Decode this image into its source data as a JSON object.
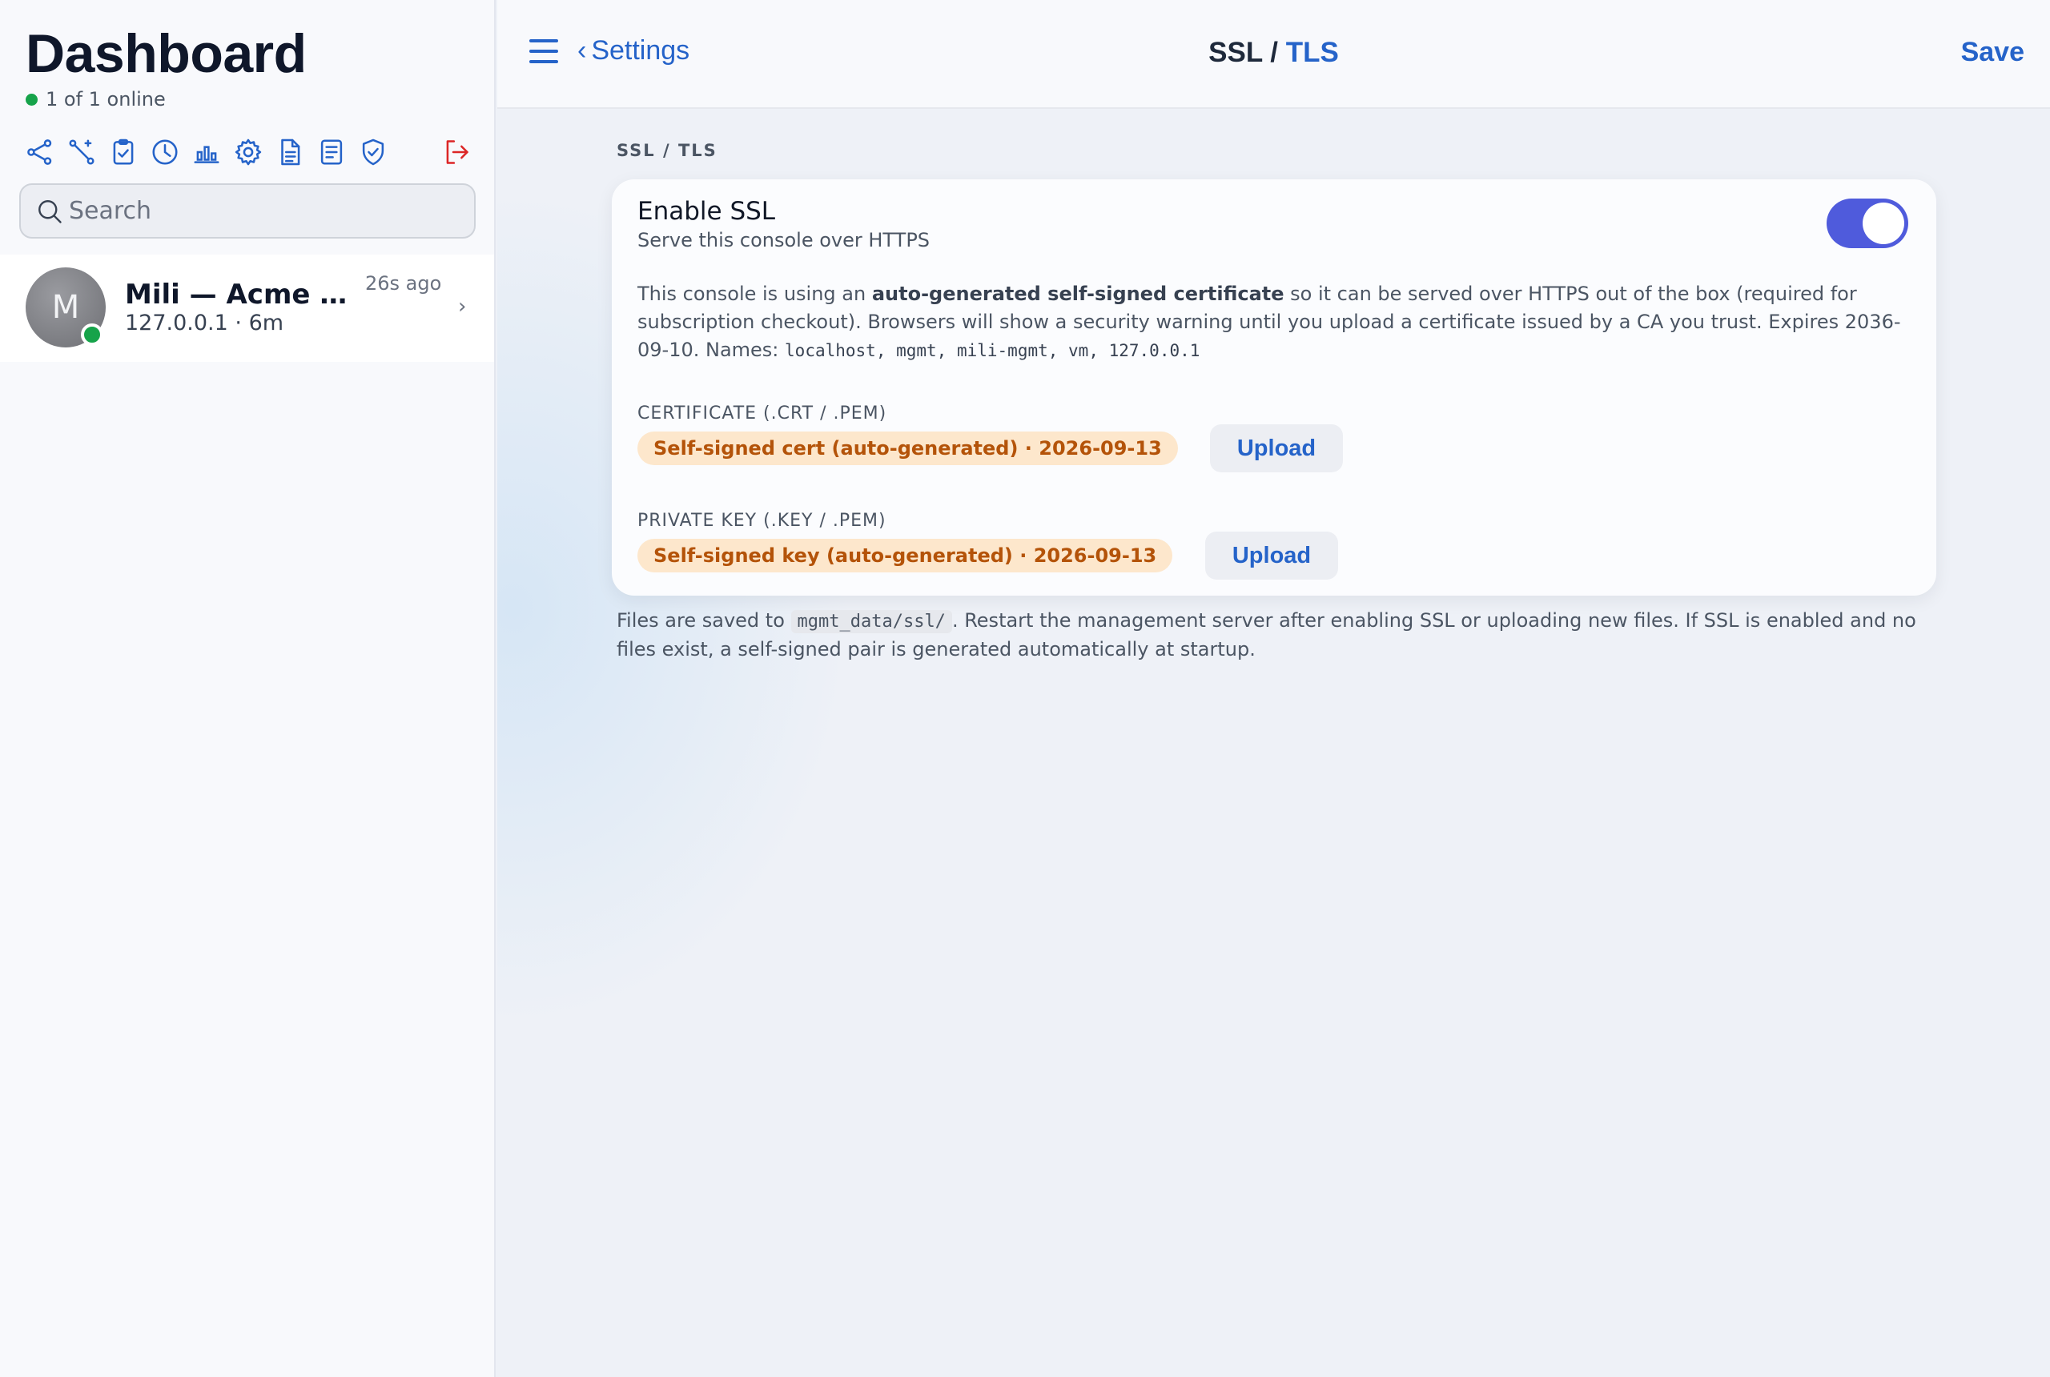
{
  "sidebar": {
    "title": "Dashboard",
    "online_status": "1 of 1 online",
    "toolbar_icons": [
      "share-nodes-icon",
      "magic-wand-icon",
      "clipboard-check-icon",
      "clock-icon",
      "bar-chart-icon",
      "gear-icon",
      "document-icon",
      "note-list-icon",
      "shield-check-icon",
      "logout-icon"
    ],
    "search": {
      "placeholder": "Search"
    },
    "devices": [
      {
        "avatar_letter": "M",
        "name": "Mili — Acme …",
        "subtitle": "127.0.0.1 · 6m",
        "last_seen": "26s ago",
        "chevron": "›"
      }
    ]
  },
  "header": {
    "back_label": "Settings",
    "back_chevron": "‹",
    "title_part1": "SSL /",
    "title_part2": "TLS",
    "save_label": "Save"
  },
  "main": {
    "section_label": "SSL / TLS",
    "enable": {
      "title": "Enable SSL",
      "subtitle": "Serve this console over HTTPS",
      "enabled": true
    },
    "description": {
      "prefix": "This console is using an ",
      "bold": "auto-generated self-signed certificate",
      "suffix": " so it can be served over HTTPS out of the box (required for subscription checkout). Browsers will show a security warning until you upload a certificate issued by a CA you trust. Expires 2036-09-10. Names: ",
      "names": "localhost, mgmt, mili-mgmt, vm, 127.0.0.1"
    },
    "certificate": {
      "label": "CERTIFICATE (.CRT / .PEM)",
      "status": "Self-signed cert (auto-generated) · 2026-09-13",
      "upload_label": "Upload"
    },
    "private_key": {
      "label": "PRIVATE KEY (.KEY / .PEM)",
      "status": "Self-signed key (auto-generated) · 2026-09-13",
      "upload_label": "Upload"
    },
    "footnote": {
      "prefix": "Files are saved to ",
      "path": "mgmt_data/ssl/",
      "suffix": ". Restart the management server after enabling SSL or uploading new files. If SSL is enabled and no files exist, a self-signed pair is generated automatically at startup."
    }
  },
  "colors": {
    "accent": "#2563c9",
    "toggle_on": "#4f5bdc",
    "online": "#16a34a",
    "logout": "#dc2626",
    "badge_bg": "#fde7cc",
    "badge_text": "#b45309"
  }
}
